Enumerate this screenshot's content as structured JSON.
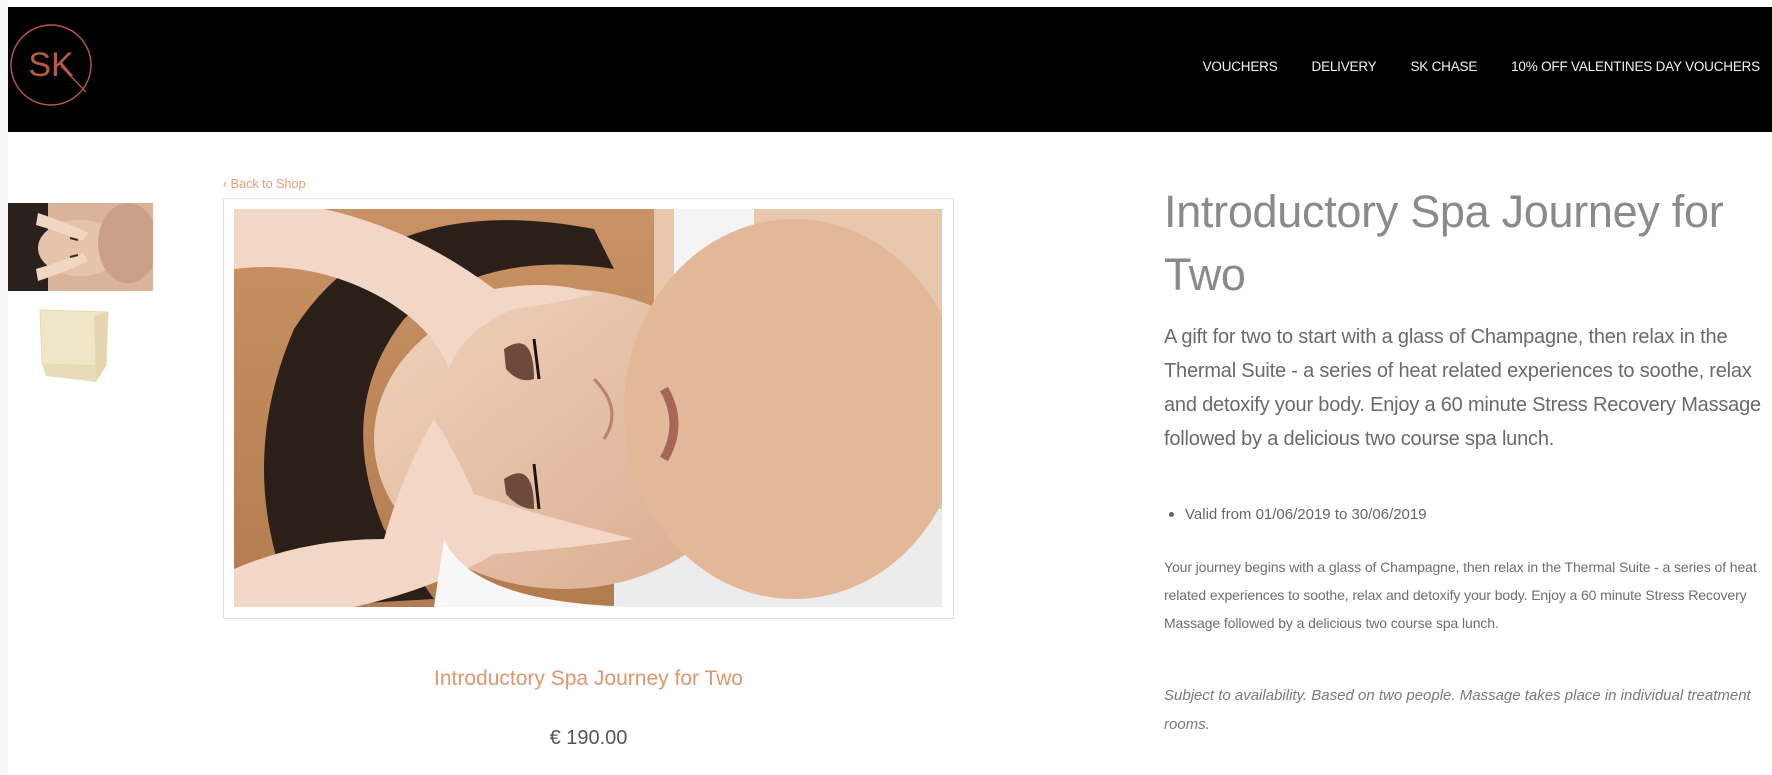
{
  "header": {
    "logo_text": "SK",
    "nav": [
      "VOUCHERS",
      "DELIVERY",
      "SK CHASE",
      "10% OFF VALENTINES DAY VOUCHERS"
    ]
  },
  "gallery": {
    "back_link": "‹ Back to Shop",
    "caption_title": "Introductory Spa Journey for Two",
    "price": "€ 190.00"
  },
  "product": {
    "title": "Introductory Spa Journey for Two",
    "lead": "A gift for two to start with a glass of Champagne, then relax in the Thermal Suite - a series of heat related experiences to soothe, relax and detoxify your body. Enjoy a 60 minute Stress Recovery Massage followed by a delicious two course spa lunch.",
    "valid": "Valid from 01/06/2019 to 30/06/2019",
    "body": "Your journey begins with a glass of Champagne, then relax in the Thermal Suite - a series of heat related experiences to soothe, relax and detoxify your body. Enjoy a 60 minute Stress Recovery Massage followed by a delicious two course spa lunch.",
    "note": "Subject to availability. Based on two people. Massage takes place in individual treatment rooms."
  },
  "colors": {
    "header_bg": "#000000",
    "logo_ring": "#b9594a",
    "accent": "#e0966e"
  }
}
